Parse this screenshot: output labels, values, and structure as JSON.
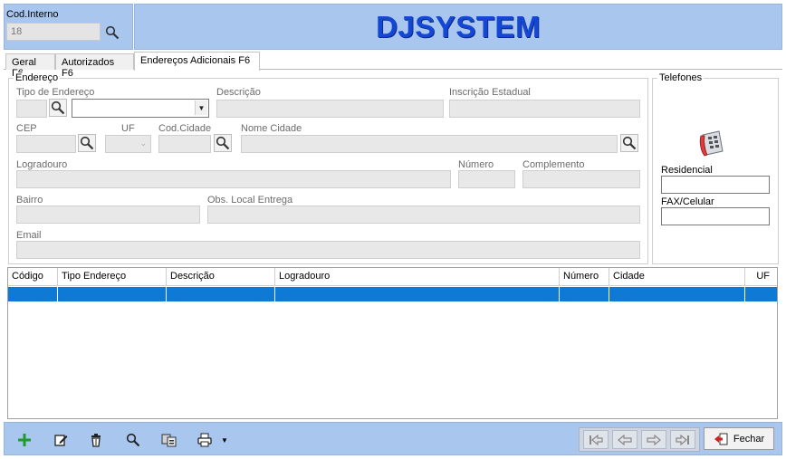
{
  "header": {
    "cod_label": "Cod.Interno",
    "cod_value": "18",
    "brand": "DJSYSTEM"
  },
  "tabs": [
    {
      "label": "Geral F6"
    },
    {
      "label": "Autorizados F6"
    },
    {
      "label": "Endereços Adicionais F6",
      "active": true
    }
  ],
  "endereco": {
    "legend": "Endereço",
    "tipo_endereco": "Tipo de Endereço",
    "descricao": "Descrição",
    "inscricao_estadual": "Inscrição Estadual",
    "cep": "CEP",
    "uf": "UF",
    "cod_cidade": "Cod.Cidade",
    "nome_cidade": "Nome Cidade",
    "logradouro": "Logradouro",
    "numero": "Número",
    "complemento": "Complemento",
    "bairro": "Bairro",
    "obs_local_entrega": "Obs. Local Entrega",
    "email": "Email"
  },
  "telefones": {
    "legend": "Telefones",
    "residencial": "Residencial",
    "fax_celular": "FAX/Celular"
  },
  "grid": {
    "columns": [
      "Código",
      "Tipo Endereço",
      "Descrição",
      "Logradouro",
      "Número",
      "Cidade",
      "UF"
    ]
  },
  "footer": {
    "close_label": "Fechar"
  },
  "colors": {
    "header_bg": "#a9c6ef",
    "brand": "#1447d6",
    "selection": "#0f7ad6"
  }
}
